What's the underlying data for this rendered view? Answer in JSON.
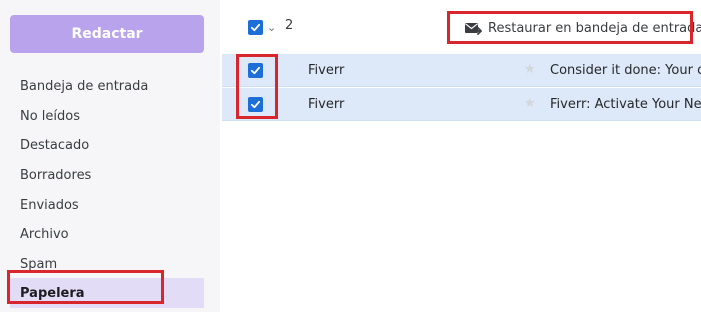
{
  "sidebar": {
    "compose_label": "Redactar",
    "items": [
      {
        "label": "Bandeja de entrada"
      },
      {
        "label": "No leídos"
      },
      {
        "label": "Destacado"
      },
      {
        "label": "Borradores"
      },
      {
        "label": "Enviados"
      },
      {
        "label": "Archivo"
      },
      {
        "label": "Spam"
      },
      {
        "label": "Papelera",
        "active": true
      }
    ]
  },
  "toolbar": {
    "selected_count": "2",
    "restore_label": "Restaurar en bandeja de entrada"
  },
  "messages": [
    {
      "sender": "Fiverr",
      "subject": "Consider it done: Your or",
      "checked": true
    },
    {
      "sender": "Fiverr",
      "subject": "Fiverr: Activate Your New",
      "checked": true
    }
  ],
  "colors": {
    "accent": "#b9a3ec",
    "checkbox": "#1d6fd7",
    "selected_row": "#dde9f8",
    "highlight": "#d9262c"
  }
}
